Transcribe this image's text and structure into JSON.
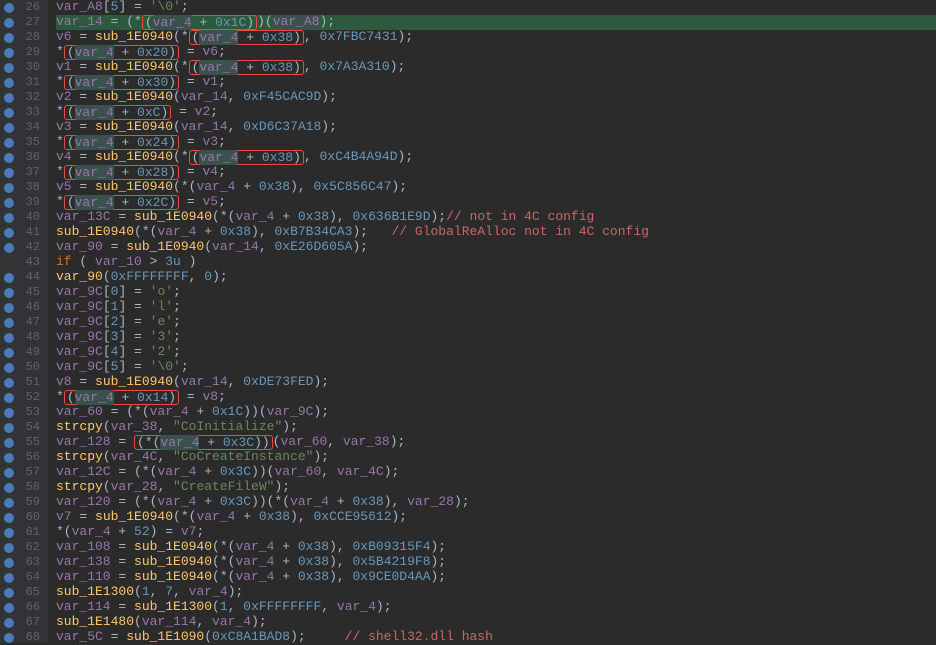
{
  "lines": [
    {
      "n": 26,
      "bp": true,
      "hl": "",
      "html": "        <span class='var'>var_A8</span><span class='plain'>[</span><span class='num'>5</span><span class='plain'>] = </span><span class='str'>'\\0'</span><span class='plain'>;</span>"
    },
    {
      "n": 27,
      "bp": true,
      "hl": "green",
      "html": "        <span class='var'>var_14</span><span class='plain'> = (</span><span class='plain'>*</span><span class='box-red'><span class='plain'>(</span><span class='var-hl'>var_4</span><span class='plain'> + </span><span class='num'>0x1C</span><span class='plain'>)</span></span><span class='plain'>)(</span><span class='var-hl'>var_A8</span><span class='plain'>);</span>"
    },
    {
      "n": 28,
      "bp": true,
      "hl": "",
      "html": "        <span class='var'>v6</span><span class='plain'> = </span><span class='fn'>sub_1E0940</span><span class='plain'>(*</span><span class='box-red'><span class='plain'>(</span><span class='var-hl'>var_4</span><span class='plain'> + </span><span class='num'>0x38</span><span class='plain'>)</span></span><span class='plain'>, </span><span class='num'>0x7FBC7431</span><span class='plain'>);</span>"
    },
    {
      "n": 29,
      "bp": true,
      "hl": "",
      "html": "        <span class='plain'>*</span><span class='box-red'><span class='plain'>(</span><span class='var-hl'>var_4</span><span class='plain'> + </span><span class='num'>0x20</span><span class='plain'>)</span></span><span class='plain'> = </span><span class='var'>v6</span><span class='plain'>;</span>"
    },
    {
      "n": 30,
      "bp": true,
      "hl": "",
      "html": "        <span class='var'>v1</span><span class='plain'> = </span><span class='fn'>sub_1E0940</span><span class='plain'>(*</span><span class='box-red'><span class='plain'>(</span><span class='var-hl'>var_4</span><span class='plain'> + </span><span class='num'>0x38</span><span class='plain'>)</span></span><span class='plain'>, </span><span class='num'>0x7A3A310</span><span class='plain'>);</span>"
    },
    {
      "n": 31,
      "bp": true,
      "hl": "",
      "html": "        <span class='plain'>*</span><span class='box-red'><span class='plain'>(</span><span class='var-hl'>var_4</span><span class='plain'> + </span><span class='num'>0x30</span><span class='plain'>)</span></span><span class='plain'> = </span><span class='var'>v1</span><span class='plain'>;</span>"
    },
    {
      "n": 32,
      "bp": true,
      "hl": "",
      "html": "        <span class='var'>v2</span><span class='plain'> = </span><span class='fn'>sub_1E0940</span><span class='plain'>(</span><span class='var'>var_14</span><span class='plain'>, </span><span class='num'>0xF45CAC9D</span><span class='plain'>);</span>"
    },
    {
      "n": 33,
      "bp": true,
      "hl": "",
      "html": "        <span class='plain'>*</span><span class='box-red'><span class='plain'>(</span><span class='var-hl'>var_4</span><span class='plain'> + </span><span class='num'>0xC</span><span class='plain'>)</span></span><span class='plain'> = </span><span class='var'>v2</span><span class='plain'>;</span>"
    },
    {
      "n": 34,
      "bp": true,
      "hl": "",
      "html": "        <span class='var'>v3</span><span class='plain'> = </span><span class='fn'>sub_1E0940</span><span class='plain'>(</span><span class='var'>var_14</span><span class='plain'>, </span><span class='num'>0xD6C37A18</span><span class='plain'>);</span>"
    },
    {
      "n": 35,
      "bp": true,
      "hl": "",
      "html": "        <span class='plain'>*</span><span class='box-red'><span class='plain'>(</span><span class='var-hl'>var_4</span><span class='plain'> + </span><span class='num'>0x24</span><span class='plain'>)</span></span><span class='plain'> = </span><span class='var'>v3</span><span class='plain'>;</span>"
    },
    {
      "n": 36,
      "bp": true,
      "hl": "",
      "html": "        <span class='var'>v4</span><span class='plain'> = </span><span class='fn'>sub_1E0940</span><span class='plain'>(*</span><span class='box-red'><span class='plain'>(</span><span class='var-hl'>var_4</span><span class='plain'> + </span><span class='num'>0x38</span><span class='plain'>)</span></span><span class='plain'>, </span><span class='num'>0xC4B4A94D</span><span class='plain'>);</span>"
    },
    {
      "n": 37,
      "bp": true,
      "hl": "",
      "html": "        <span class='plain'>*</span><span class='box-red'><span class='plain'>(</span><span class='var-hl'>var_4</span><span class='plain'> + </span><span class='num'>0x28</span><span class='plain'>)</span></span><span class='plain'> = </span><span class='var'>v4</span><span class='plain'>;</span>"
    },
    {
      "n": 38,
      "bp": true,
      "hl": "",
      "html": "        <span class='var'>v5</span><span class='plain'> = </span><span class='fn'>sub_1E0940</span><span class='plain'>(*(</span><span class='var'>var_4</span><span class='plain'> + </span><span class='num'>0x38</span><span class='plain'>), </span><span class='num'>0x5C856C47</span><span class='plain'>);</span>"
    },
    {
      "n": 39,
      "bp": true,
      "hl": "",
      "html": "        <span class='plain'>*</span><span class='box-red'><span class='plain'>(</span><span class='var-hl'>var_4</span><span class='plain'> + </span><span class='num'>0x2C</span><span class='plain'>)</span></span><span class='plain'> = </span><span class='var'>v5</span><span class='plain'>;</span>"
    },
    {
      "n": 40,
      "bp": true,
      "hl": "",
      "html": "        <span class='var'>var_13C</span><span class='plain'> = </span><span class='fn'>sub_1E0940</span><span class='plain'>(*(</span><span class='var'>var_4</span><span class='plain'> + </span><span class='num'>0x38</span><span class='plain'>), </span><span class='num'>0x636B1E9D</span><span class='plain'>);</span><span class='cmt-red'>// not in 4C config</span>"
    },
    {
      "n": 41,
      "bp": true,
      "hl": "",
      "html": "        <span class='fn'>sub_1E0940</span><span class='plain'>(*(</span><span class='var'>var_4</span><span class='plain'> + </span><span class='num'>0x38</span><span class='plain'>), </span><span class='num'>0xB7B34CA3</span><span class='plain'>);   </span><span class='cmt-red'>// GlobalReAlloc not in 4C config</span>"
    },
    {
      "n": 42,
      "bp": true,
      "hl": "",
      "html": "        <span class='var'>var_90</span><span class='plain'> = </span><span class='fn'>sub_1E0940</span><span class='plain'>(</span><span class='var'>var_14</span><span class='plain'>, </span><span class='num'>0xE26D605A</span><span class='plain'>);</span>"
    },
    {
      "n": 43,
      "bp": false,
      "hl": "",
      "html": "        <span class='kw'>if</span><span class='plain'> ( </span><span class='var'>var_10</span><span class='plain'> > </span><span class='num'>3u</span><span class='plain'> )</span>"
    },
    {
      "n": 44,
      "bp": true,
      "hl": "",
      "html": "          <span class='fn'>var_90</span><span class='plain'>(</span><span class='num'>0xFFFFFFFF</span><span class='plain'>, </span><span class='num'>0</span><span class='plain'>);</span>"
    },
    {
      "n": 45,
      "bp": true,
      "hl": "",
      "html": "        <span class='var'>var_9C</span><span class='plain'>[</span><span class='num'>0</span><span class='plain'>] = </span><span class='str'>'o'</span><span class='plain'>;</span>"
    },
    {
      "n": 46,
      "bp": true,
      "hl": "",
      "html": "        <span class='var'>var_9C</span><span class='plain'>[</span><span class='num'>1</span><span class='plain'>] = </span><span class='str'>'l'</span><span class='plain'>;</span>"
    },
    {
      "n": 47,
      "bp": true,
      "hl": "",
      "html": "        <span class='var'>var_9C</span><span class='plain'>[</span><span class='num'>2</span><span class='plain'>] = </span><span class='str'>'e'</span><span class='plain'>;</span>"
    },
    {
      "n": 48,
      "bp": true,
      "hl": "",
      "html": "        <span class='var'>var_9C</span><span class='plain'>[</span><span class='num'>3</span><span class='plain'>] = </span><span class='str'>'3'</span><span class='plain'>;</span>"
    },
    {
      "n": 49,
      "bp": true,
      "hl": "",
      "html": "        <span class='var'>var_9C</span><span class='plain'>[</span><span class='num'>4</span><span class='plain'>] = </span><span class='str'>'2'</span><span class='plain'>;</span>"
    },
    {
      "n": 50,
      "bp": true,
      "hl": "",
      "html": "        <span class='var'>var_9C</span><span class='plain'>[</span><span class='num'>5</span><span class='plain'>] = </span><span class='str'>'\\0'</span><span class='plain'>;</span>"
    },
    {
      "n": 51,
      "bp": true,
      "hl": "",
      "html": "        <span class='var'>v8</span><span class='plain'> = </span><span class='fn'>sub_1E0940</span><span class='plain'>(</span><span class='var'>var_14</span><span class='plain'>, </span><span class='num'>0xDE73FED</span><span class='plain'>);</span>"
    },
    {
      "n": 52,
      "bp": true,
      "hl": "",
      "html": "        <span class='plain'>*</span><span class='box-red'><span class='plain'>(</span><span class='var-hl'>var_4</span><span class='plain'> + </span><span class='num'>0x14</span><span class='plain'>)</span></span><span class='plain'> = </span><span class='var'>v8</span><span class='plain'>;</span>"
    },
    {
      "n": 53,
      "bp": true,
      "hl": "",
      "html": "        <span class='var'>var_60</span><span class='plain'> = (*(</span><span class='var'>var_4</span><span class='plain'> + </span><span class='num'>0x1C</span><span class='plain'>))(</span><span class='var'>var_9C</span><span class='plain'>);</span>"
    },
    {
      "n": 54,
      "bp": true,
      "hl": "",
      "html": "        <span class='fn'>strcpy</span><span class='plain'>(</span><span class='var'>var_38</span><span class='plain'>, </span><span class='str'>\"CoInitialize\"</span><span class='plain'>);</span>"
    },
    {
      "n": 55,
      "bp": true,
      "hl": "",
      "html": "        <span class='var'>var_128</span><span class='plain'> = </span><span class='box-red'><span class='plain'>(*(</span><span class='var-hl'>var_4</span><span class='plain'> + </span><span class='num'>0x3C</span><span class='plain'>))</span></span><span class='plain'>(</span><span class='var'>var_60</span><span class='plain'>, </span><span class='var'>var_38</span><span class='plain'>);</span>"
    },
    {
      "n": 56,
      "bp": true,
      "hl": "",
      "html": "        <span class='fn'>strcpy</span><span class='plain'>(</span><span class='var'>var_4C</span><span class='plain'>, </span><span class='str'>\"CoCreateInstance\"</span><span class='plain'>);</span>"
    },
    {
      "n": 57,
      "bp": true,
      "hl": "",
      "html": "        <span class='var'>var_12C</span><span class='plain'> = (*(</span><span class='var'>var_4</span><span class='plain'> + </span><span class='num'>0x3C</span><span class='plain'>))(</span><span class='var'>var_60</span><span class='plain'>, </span><span class='var'>var_4C</span><span class='plain'>);</span>"
    },
    {
      "n": 58,
      "bp": true,
      "hl": "",
      "html": "        <span class='fn'>strcpy</span><span class='plain'>(</span><span class='var'>var_28</span><span class='plain'>, </span><span class='str'>\"CreateFileW\"</span><span class='plain'>);</span>"
    },
    {
      "n": 59,
      "bp": true,
      "hl": "",
      "html": "        <span class='var'>var_120</span><span class='plain'> = (*(</span><span class='var'>var_4</span><span class='plain'> + </span><span class='num'>0x3C</span><span class='plain'>))(*(</span><span class='var'>var_4</span><span class='plain'> + </span><span class='num'>0x38</span><span class='plain'>), </span><span class='var'>var_28</span><span class='plain'>);</span>"
    },
    {
      "n": 60,
      "bp": true,
      "hl": "",
      "html": "        <span class='var'>v7</span><span class='plain'> = </span><span class='fn'>sub_1E0940</span><span class='plain'>(*(</span><span class='var'>var_4</span><span class='plain'> + </span><span class='num'>0x38</span><span class='plain'>), </span><span class='num'>0xCCE95612</span><span class='plain'>);</span>"
    },
    {
      "n": 61,
      "bp": true,
      "hl": "",
      "html": "        <span class='plain'>*(</span><span class='var'>var_4</span><span class='plain'> + </span><span class='num'>52</span><span class='plain'>) = </span><span class='var'>v7</span><span class='plain'>;</span>"
    },
    {
      "n": 62,
      "bp": true,
      "hl": "",
      "html": "        <span class='var'>var_108</span><span class='plain'> = </span><span class='fn'>sub_1E0940</span><span class='plain'>(*(</span><span class='var'>var_4</span><span class='plain'> + </span><span class='num'>0x38</span><span class='plain'>), </span><span class='num'>0xB09315F4</span><span class='plain'>);</span>"
    },
    {
      "n": 63,
      "bp": true,
      "hl": "",
      "html": "        <span class='var'>var_138</span><span class='plain'> = </span><span class='fn'>sub_1E0940</span><span class='plain'>(*(</span><span class='var'>var_4</span><span class='plain'> + </span><span class='num'>0x38</span><span class='plain'>), </span><span class='num'>0x5B4219F8</span><span class='plain'>);</span>"
    },
    {
      "n": 64,
      "bp": true,
      "hl": "",
      "html": "        <span class='var'>var_110</span><span class='plain'> = </span><span class='fn'>sub_1E0940</span><span class='plain'>(*(</span><span class='var'>var_4</span><span class='plain'> + </span><span class='num'>0x38</span><span class='plain'>), </span><span class='num'>0x9CE0D4AA</span><span class='plain'>);</span>"
    },
    {
      "n": 65,
      "bp": true,
      "hl": "",
      "html": "        <span class='fn'>sub_1E1300</span><span class='plain'>(</span><span class='num'>1</span><span class='plain'>, </span><span class='num'>7</span><span class='plain'>, </span><span class='var'>var_4</span><span class='plain'>);</span>"
    },
    {
      "n": 66,
      "bp": true,
      "hl": "",
      "html": "        <span class='var'>var_114</span><span class='plain'> = </span><span class='fn'>sub_1E1300</span><span class='plain'>(</span><span class='num'>1</span><span class='plain'>, </span><span class='num'>0xFFFFFFFF</span><span class='plain'>, </span><span class='var'>var_4</span><span class='plain'>);</span>"
    },
    {
      "n": 67,
      "bp": true,
      "hl": "",
      "html": "        <span class='fn'>sub_1E1480</span><span class='plain'>(</span><span class='var'>var_114</span><span class='plain'>, </span><span class='var'>var_4</span><span class='plain'>);</span>"
    },
    {
      "n": 68,
      "bp": true,
      "hl": "",
      "html": "        <span class='var'>var_5C</span><span class='plain'> = </span><span class='fn'>sub_1E1090</span><span class='plain'>(</span><span class='num'>0xC8A1BAD8</span><span class='plain'>);     </span><span class='cmt-red'>// shell32.dll hash</span>"
    }
  ]
}
